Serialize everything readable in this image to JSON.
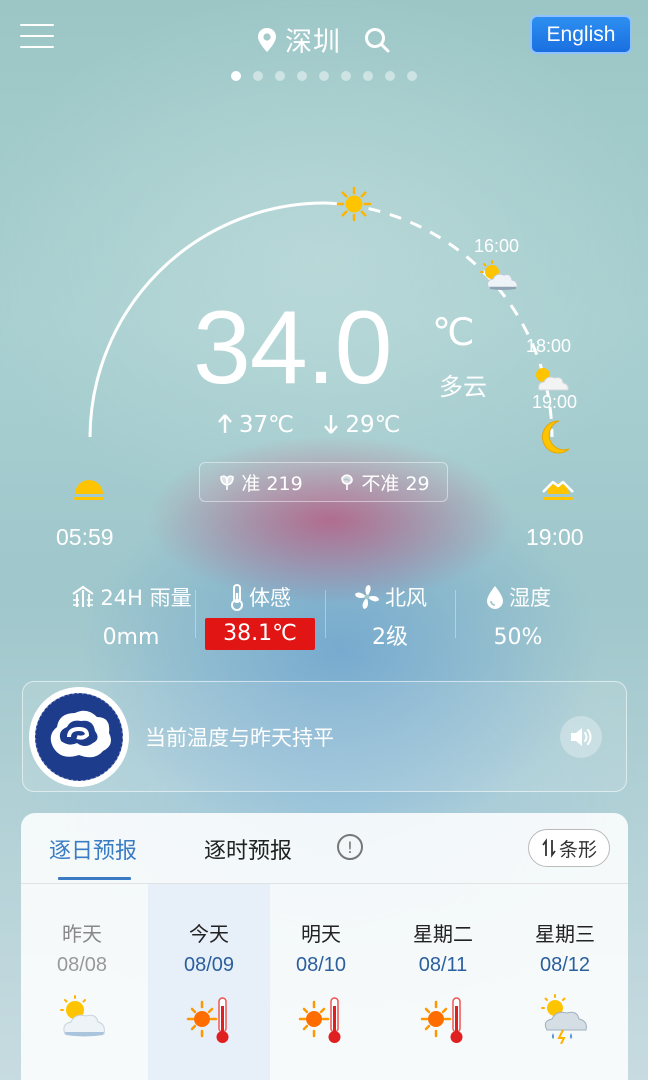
{
  "header": {
    "city": "深圳",
    "language_button": "English",
    "page_count": 9,
    "active_page": 1
  },
  "sun_arc": {
    "hour_labels": [
      "16:00",
      "18:00",
      "19:00"
    ],
    "sunrise_time": "05:59",
    "sunset_time": "19:00"
  },
  "current": {
    "temperature": "34.0",
    "unit": "℃",
    "description": "多云",
    "high": "37℃",
    "low": "29℃"
  },
  "accuracy": {
    "correct_label": "准 219",
    "incorrect_label": "不准 29"
  },
  "stats": [
    {
      "label": "24H 雨量",
      "value": "0mm",
      "icon": "rain-gauge-icon"
    },
    {
      "label": "体感",
      "value": "38.1℃",
      "icon": "thermometer-icon",
      "highlight": "#e21515"
    },
    {
      "label": "北风",
      "value": "2级",
      "icon": "fan-icon"
    },
    {
      "label": "湿度",
      "value": "50%",
      "icon": "droplet-icon"
    }
  ],
  "notice": {
    "text": "当前温度与昨天持平"
  },
  "forecast": {
    "tabs": [
      "逐日预报",
      "逐时预报"
    ],
    "active_tab": 0,
    "view_toggle": "条形",
    "days": [
      {
        "name": "昨天",
        "date": "08/08",
        "icon": "partly-cloudy-icon"
      },
      {
        "name": "今天",
        "date": "08/09",
        "icon": "sunny-hot-icon"
      },
      {
        "name": "明天",
        "date": "08/10",
        "icon": "sunny-hot-icon"
      },
      {
        "name": "星期二",
        "date": "08/11",
        "icon": "sunny-hot-icon"
      },
      {
        "name": "星期三",
        "date": "08/12",
        "icon": "thunder-shower-icon"
      }
    ]
  },
  "colors": {
    "accent": "#3a7cc4",
    "language_button": "#1a6fe0",
    "feels_like_badge": "#e21515"
  }
}
